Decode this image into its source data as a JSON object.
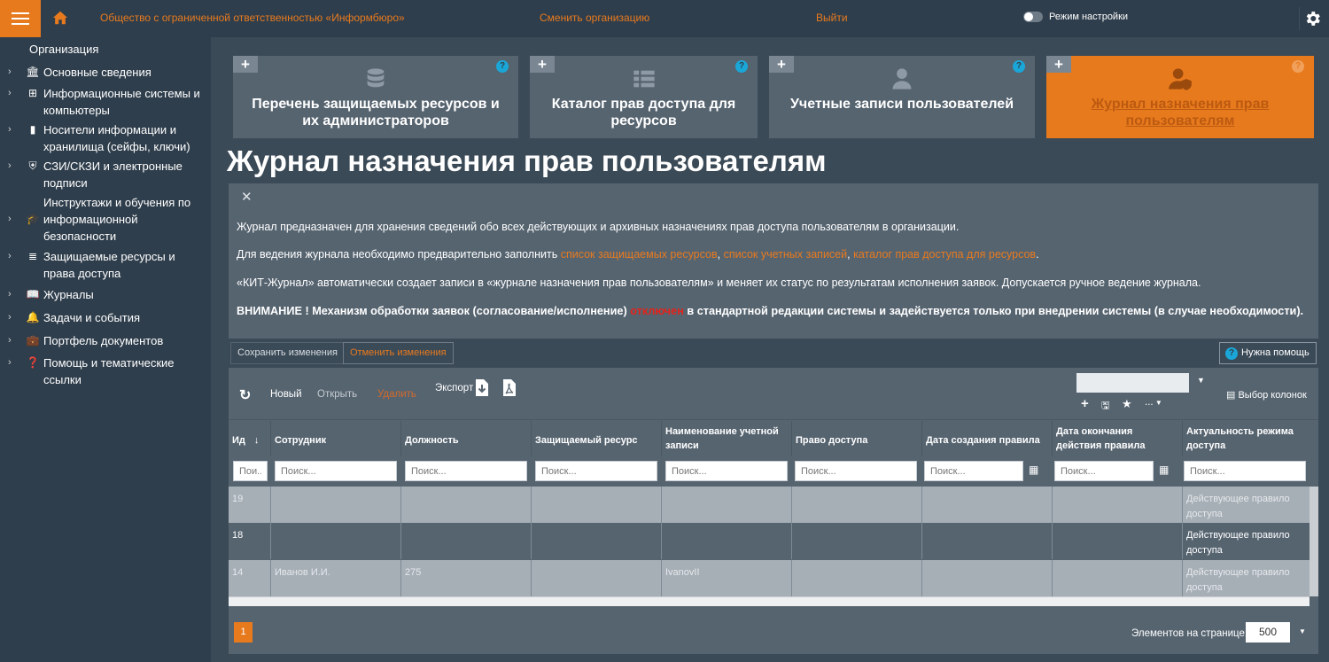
{
  "header": {
    "org_name": "Общество с ограниченной ответственностью «Информбюро»",
    "change_org": "Сменить организацию",
    "logout": "Выйти",
    "settings_mode": "Режим настройки"
  },
  "sidebar": {
    "section_title": "Организация",
    "items": [
      {
        "label": "Основные сведения",
        "icon": "bank-icon"
      },
      {
        "label": "Информационные системы и компьютеры",
        "icon": "network-icon"
      },
      {
        "label": "Носители информации и хранилища (сейфы, ключи)",
        "icon": "usb-icon"
      },
      {
        "label": "СЗИ/СКЗИ и электронные подписи",
        "icon": "shield-icon"
      },
      {
        "label": "Инструктажи и обучения по информационной безопасности",
        "icon": "graduation-cap-icon"
      },
      {
        "label": "Защищаемые ресурсы и права доступа",
        "icon": "database-icon"
      },
      {
        "label": "Журналы",
        "icon": "book-icon"
      },
      {
        "label": "Задачи и события",
        "icon": "bell-icon"
      },
      {
        "label": "Портфель документов",
        "icon": "briefcase-icon"
      },
      {
        "label": "Помощь и тематические ссылки",
        "icon": "question-icon"
      }
    ]
  },
  "tiles": [
    {
      "label": "Перечень защищаемых ресурсов и их администраторов",
      "icon": "database-icon"
    },
    {
      "label": "Каталог прав доступа для ресурсов",
      "icon": "list-icon"
    },
    {
      "label": "Учетные записи пользователей",
      "icon": "user-icon"
    },
    {
      "label": "Журнал назначения прав пользователям",
      "icon": "user-shield-icon"
    }
  ],
  "page_title": "Журнал назначения прав пользователям",
  "info": {
    "p1": "Журнал предназначен для хранения сведений обо всех действующих и архивных назначениях прав доступа пользователям в организации.",
    "p2_prefix": "Для ведения журнала необходимо предварительно заполнить ",
    "p2_link1": "список защищаемых ресурсов",
    "p2_sep1": ", ",
    "p2_link2": "список учетных записей",
    "p2_sep2": ", ",
    "p2_link3": "каталог прав доступа для ресурсов",
    "p2_suffix": ".",
    "p3": "«КИТ-Журнал» автоматически создает записи в «журнале назначения прав пользователям» и меняет их статус по результатам исполнения заявок. Допускается ручное ведение журнала.",
    "p4_prefix": "ВНИМАНИЕ ! Механизм обработки заявок (согласование/исполнение) ",
    "p4_red": "отключен",
    "p4_suffix": " в стандартной редакции системы и задействуется только при внедрении системы (в случае необходимости)."
  },
  "actions": {
    "save": "Сохранить изменения",
    "cancel": "Отменить изменения",
    "help": "Нужна помощь"
  },
  "toolbar": {
    "new": "Новый",
    "open": "Открыть",
    "delete": "Удалить",
    "export": "Экспорт",
    "column_choice": "Выбор колонок",
    "more": "...",
    "view_select": ""
  },
  "table": {
    "headers": [
      "Ид",
      "Сотрудник",
      "Должность",
      "Защищаемый ресурс",
      "Наименование учетной записи",
      "Право доступа",
      "Дата создания правила",
      "Дата окончания действия правила",
      "Актуальность режима доступа"
    ],
    "filter_placeholders": [
      "Пои...",
      "Поиск...",
      "Поиск...",
      "Поиск...",
      "Поиск...",
      "Поиск...",
      "Поиск...",
      "Поиск...",
      "Поиск..."
    ],
    "rows": [
      [
        "19",
        "",
        "",
        "",
        "",
        "",
        "",
        "",
        "Действующее правило доступа"
      ],
      [
        "18",
        "",
        "",
        "",
        "",
        "",
        "",
        "",
        "Действующее правило доступа"
      ],
      [
        "14",
        "Иванов И.И.",
        "275",
        "",
        "IvanovII",
        "",
        "",
        "",
        "Действующее правило доступа"
      ]
    ]
  },
  "pagination": {
    "current_page": "1",
    "per_page_label": "Элементов на странице:",
    "per_page_value": "500"
  },
  "colors": {
    "accent": "#e87a1e",
    "background": "#2f3e4c",
    "panel": "#566470",
    "help_blue": "#1aa7d8",
    "alert_red": "#e2231a"
  }
}
